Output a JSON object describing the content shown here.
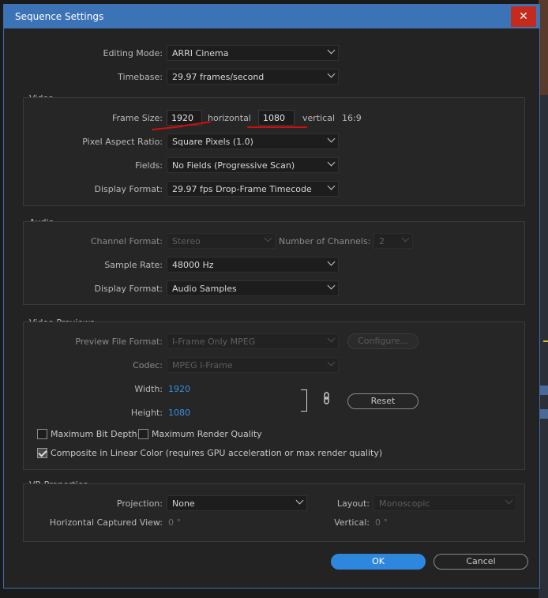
{
  "window": {
    "title": "Sequence Settings",
    "close_label": "✕"
  },
  "general": {
    "editing_mode_label": "Editing Mode:",
    "editing_mode": "ARRI Cinema",
    "timebase_label": "Timebase:",
    "timebase": "29.97  frames/second"
  },
  "video": {
    "section_title": "Video",
    "frame_size_label": "Frame Size:",
    "frame_width": "1920",
    "horizontal_label": "horizontal",
    "frame_height": "1080",
    "vertical_label": "vertical",
    "aspect": "16:9",
    "pixel_aspect_label": "Pixel Aspect Ratio:",
    "pixel_aspect": "Square Pixels (1.0)",
    "fields_label": "Fields:",
    "fields": "No Fields (Progressive Scan)",
    "display_format_label": "Display Format:",
    "display_format": "29.97 fps Drop-Frame Timecode"
  },
  "audio": {
    "section_title": "Audio",
    "channel_format_label": "Channel Format:",
    "channel_format": "Stereo",
    "num_channels_label": "Number of Channels:",
    "num_channels": "2",
    "sample_rate_label": "Sample Rate:",
    "sample_rate": "48000 Hz",
    "display_format_label": "Display Format:",
    "display_format": "Audio Samples"
  },
  "previews": {
    "section_title": "Video Previews",
    "file_format_label": "Preview File Format:",
    "file_format": "I-Frame Only MPEG",
    "configure_label": "Configure...",
    "codec_label": "Codec:",
    "codec": "MPEG I-Frame",
    "width_label": "Width:",
    "width": "1920",
    "height_label": "Height:",
    "height": "1080",
    "reset_label": "Reset",
    "max_bit_depth_label": "Maximum Bit Depth",
    "max_render_quality_label": "Maximum Render Quality",
    "composite_linear_label": "Composite in Linear Color (requires GPU acceleration or max render quality)"
  },
  "vr": {
    "section_title": "VR Properties",
    "projection_label": "Projection:",
    "projection": "None",
    "layout_label": "Layout:",
    "layout": "Monoscopic",
    "h_view_label": "Horizontal Captured View:",
    "h_view": "0 °",
    "vertical_label": "Vertical:",
    "vertical": "0 °"
  },
  "buttons": {
    "ok": "OK",
    "cancel": "Cancel"
  },
  "colors": {
    "accent": "#2f86dd",
    "titlebar": "#3c73b7",
    "annotation": "#d01010"
  }
}
